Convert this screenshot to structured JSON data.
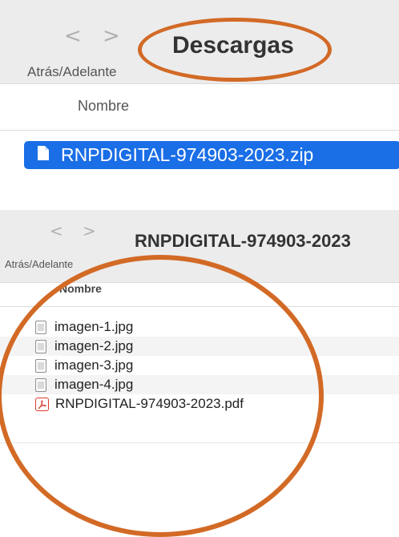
{
  "window1": {
    "title": "Descargas",
    "nav_back": "<",
    "nav_forward": ">",
    "nav_label": "Atrás/Adelante",
    "column_header": "Nombre",
    "selected_file": "RNPDIGITAL-974903-2023.zip"
  },
  "window2": {
    "title": "RNPDIGITAL-974903-2023",
    "nav_back": "<",
    "nav_forward": ">",
    "nav_label": "Atrás/Adelante",
    "column_header": "Nombre",
    "files": [
      {
        "name": "imagen-1.jpg",
        "type": "image"
      },
      {
        "name": "imagen-2.jpg",
        "type": "image"
      },
      {
        "name": "imagen-3.jpg",
        "type": "image"
      },
      {
        "name": "imagen-4.jpg",
        "type": "image"
      },
      {
        "name": "RNPDIGITAL-974903-2023.pdf",
        "type": "pdf"
      }
    ]
  },
  "colors": {
    "annotation": "#d26a26",
    "selection": "#1a6ee6",
    "pdf_icon": "#d93a2b"
  }
}
